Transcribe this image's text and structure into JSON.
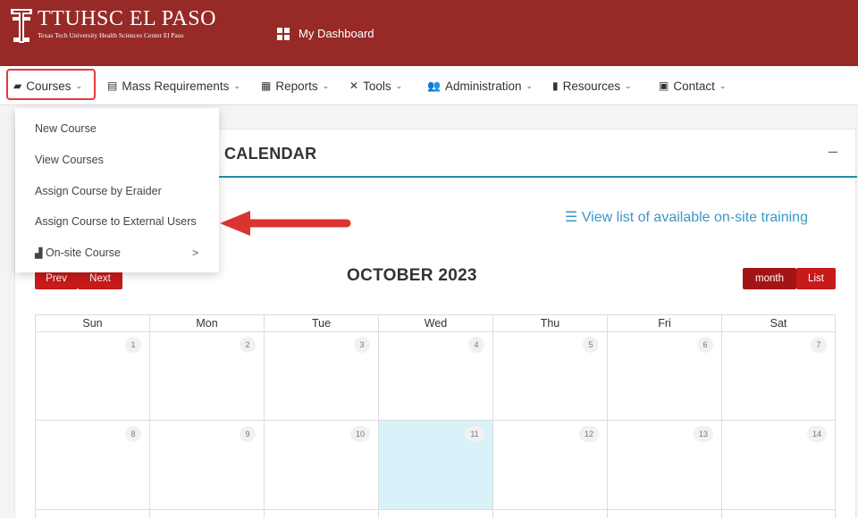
{
  "header": {
    "logo_title": "TTUHSC EL PASO",
    "logo_subtitle": "Texas Tech University Health Sciences Center El Paso",
    "dashboard_label": "My Dashboard",
    "background": "#972a26"
  },
  "nav": {
    "items": [
      {
        "label": "Courses",
        "icon": "book-icon"
      },
      {
        "label": "Mass Requirements",
        "icon": "calendar-icon"
      },
      {
        "label": "Reports",
        "icon": "report-icon"
      },
      {
        "label": "Tools",
        "icon": "tools-icon"
      },
      {
        "label": "Administration",
        "icon": "users-icon"
      },
      {
        "label": "Resources",
        "icon": "resources-icon"
      },
      {
        "label": "Contact",
        "icon": "contact-icon"
      }
    ]
  },
  "dropdown": {
    "items": [
      {
        "label": "New Course"
      },
      {
        "label": "View Courses"
      },
      {
        "label": "Assign Course by Eraider"
      },
      {
        "label": "Assign Course to External Users"
      },
      {
        "label": "On-site Course",
        "icon": "building-icon",
        "submenu_caret": ">"
      }
    ]
  },
  "card": {
    "title": "CALENDAR",
    "minimize": "–",
    "view_link": "View list of available on-site training"
  },
  "calendar": {
    "month_title": "OCTOBER 2023",
    "prev_label": "Prev",
    "next_label": "Next",
    "month_label": "month",
    "list_label": "List",
    "weekdays": [
      "Sun",
      "Mon",
      "Tue",
      "Wed",
      "Thu",
      "Fri",
      "Sat"
    ],
    "weeks": [
      [
        "1",
        "2",
        "3",
        "4",
        "5",
        "6",
        "7"
      ],
      [
        "8",
        "9",
        "10",
        "11",
        "12",
        "13",
        "14"
      ]
    ],
    "today": "11",
    "accent": "#c71a1a",
    "today_color": "#d9f1f8"
  }
}
